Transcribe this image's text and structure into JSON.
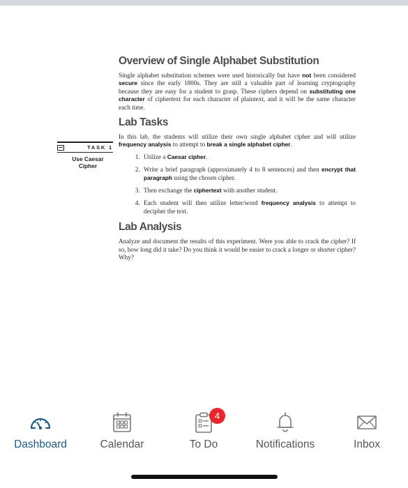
{
  "document": {
    "overview": {
      "heading": "Overview of Single Alphabet Substitution",
      "t1": "Single alphabet substitution schemes were used historically but have ",
      "k1": "not",
      "t2": " been considered ",
      "k2": "secure",
      "t3": " since the early 1800s. They are still a valuable part of learning cryptography because they are easy for a student to grasp. These ciphers depend on ",
      "k3": "substituting one character",
      "t4": " of ciphertext for each character of plaintext, and it will be the same character each time."
    },
    "lab_tasks": {
      "heading": "Lab Tasks",
      "t1": "In this lab, the students will utilize their own single alphabet cipher and will utilize ",
      "k1": "frequency analysis",
      "t2": " to attempt to ",
      "k2": "break a single alphabet cipher",
      "t3": ".",
      "items": [
        {
          "t1": "Utilize a ",
          "k1": "Caesar cipher",
          "t2": "."
        },
        {
          "t1": "Write a brief paragraph (approximately 4 to 8 sentences) and then ",
          "k1": "encrypt that paragraph",
          "t2": " using the chosen cipher."
        },
        {
          "t1": "Then exchange the ",
          "k1": "ciphertext",
          "t2": " with another student."
        },
        {
          "t1": "Each student will then utilize letter/word ",
          "k1": "frequency analysis",
          "t2": " to attempt to decipher the text."
        }
      ]
    },
    "lab_analysis": {
      "heading": "Lab Analysis",
      "text": "Analyze and document the results of this experiment. Were you able to crack the cipher? If so, how long did it take? Do you think it would be easier to crack a longer or shorter cipher? Why?"
    },
    "task_box": {
      "tag": "TASK 1",
      "caption_line1": "Use Caesar",
      "caption_line2": "Cipher"
    }
  },
  "tabbar": {
    "accent_color": "#1f5c86",
    "tabs": [
      {
        "label": "Dashboard",
        "icon": "dashboard-gauge-icon",
        "active": true
      },
      {
        "label": "Calendar",
        "icon": "calendar-icon",
        "active": false
      },
      {
        "label": "To Do",
        "icon": "todo-clipboard-icon",
        "active": false,
        "badge": "4"
      },
      {
        "label": "Notifications",
        "icon": "bell-icon",
        "active": false
      },
      {
        "label": "Inbox",
        "icon": "envelope-icon",
        "active": false
      }
    ]
  }
}
